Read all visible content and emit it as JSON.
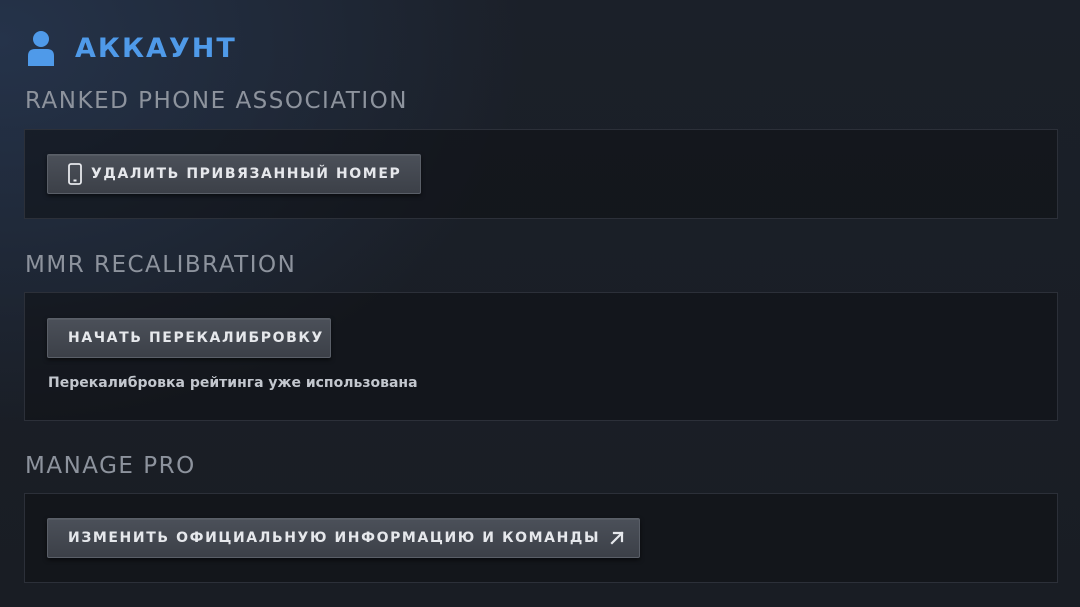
{
  "header": {
    "title": "АККАУНТ",
    "icon": "user-icon",
    "accent_color": "#4f9ae9"
  },
  "sections": [
    {
      "title": "RANKED PHONE ASSOCIATION",
      "button": {
        "label": "УДАЛИТЬ ПРИВЯЗАННЫЙ НОМЕР",
        "icon": "phone-icon"
      }
    },
    {
      "title": "MMR RECALIBRATION",
      "button": {
        "label": "НАЧАТЬ ПЕРЕКАЛИБРОВКУ"
      },
      "note": "Перекалибровка рейтинга уже использована"
    },
    {
      "title": "MANAGE PRO",
      "button": {
        "label": "ИЗМЕНИТЬ ОФИЦИАЛЬНУЮ ИНФОРМАЦИЮ И КОМАНДЫ",
        "icon": "external-link-arrow-icon"
      }
    }
  ]
}
